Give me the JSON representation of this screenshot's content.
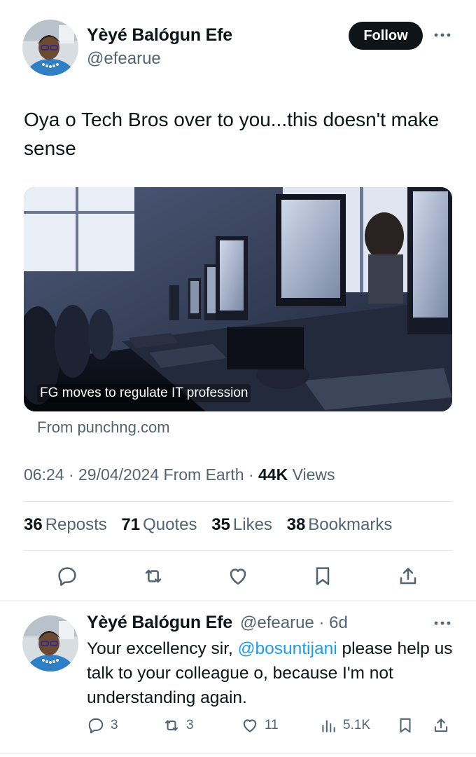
{
  "tweet": {
    "author": {
      "name": "Yèyé Balógun Efe",
      "handle": "@efearue"
    },
    "follow_label": "Follow",
    "text": "Oya o Tech Bros over to you...this doesn't make sense",
    "card": {
      "title": "FG moves to regulate IT profession",
      "source": "From punchng.com"
    },
    "meta": {
      "time": "06:24",
      "date": "29/04/2024",
      "source_label": "From Earth",
      "views_count": "44K",
      "views_label": "Views"
    },
    "stats": [
      {
        "count": "36",
        "label": "Reposts"
      },
      {
        "count": "71",
        "label": "Quotes"
      },
      {
        "count": "35",
        "label": "Likes"
      },
      {
        "count": "38",
        "label": "Bookmarks"
      }
    ],
    "actions": [
      "reply-icon",
      "repost-icon",
      "like-icon",
      "bookmark-icon",
      "share-icon"
    ]
  },
  "reply": {
    "author": {
      "name": "Yèyé Balógun Efe",
      "handle": "@efearue",
      "age": "6d"
    },
    "text_before": "Your excellency sir, ",
    "mention": "@bosuntijani",
    "text_after": " please help us talk to your colleague o, because I'm not understanding again.",
    "actions": {
      "replies": "3",
      "reposts": "3",
      "likes": "11",
      "views": "5.1K"
    }
  },
  "colors": {
    "text": "#0f1419",
    "secondary": "#536471",
    "accent": "#1d9bf0",
    "follow_bg": "#0f1419",
    "divider": "#eff3f4"
  }
}
